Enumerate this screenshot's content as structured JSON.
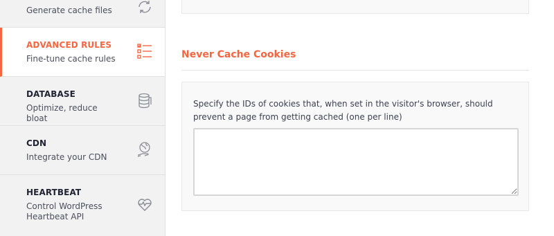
{
  "sidebar": {
    "items": [
      {
        "title": "",
        "description": "Generate cache files",
        "icon": "refresh-icon"
      },
      {
        "title": "ADVANCED RULES",
        "description": "Fine-tune cache rules",
        "icon": "list-rules-icon",
        "active": true
      },
      {
        "title": "DATABASE",
        "description": "Optimize, reduce bloat",
        "icon": "database-icon"
      },
      {
        "title": "CDN",
        "description": "Integrate your CDN",
        "icon": "globe-hand-icon"
      },
      {
        "title": "HEARTBEAT",
        "description": "Control WordPress Heartbeat API",
        "icon": "heartbeat-icon"
      }
    ]
  },
  "main": {
    "section_title": "Never Cache Cookies",
    "field_label": "Specify the IDs of cookies that, when set in the visitor's browser, should prevent a page from getting cached (one per line)",
    "textarea_value": ""
  },
  "colors": {
    "accent": "#f56640",
    "sidebar_bg": "#f2f2f2",
    "card_bg": "#f9f9f9"
  }
}
